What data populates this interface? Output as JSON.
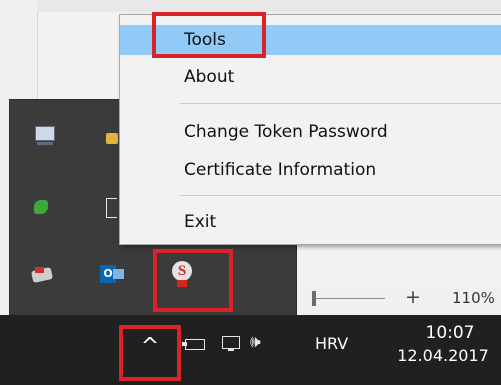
{
  "background": {
    "zoom": {
      "label": "110%",
      "plus_symbol": "+"
    }
  },
  "tray_overflow": {
    "icons": [
      "monitor-icon",
      "lock-icon",
      "green-app-icon",
      "usb-drive-icon",
      "printer-icon",
      "outlook-icon",
      "certificate-token-icon"
    ],
    "outlook_letter": "O",
    "cert_letter": "S"
  },
  "context_menu": {
    "items": [
      {
        "label": "Tools",
        "highlighted": true
      },
      {
        "label": "About"
      },
      {
        "label": "Change Token Password"
      },
      {
        "label": "Certificate Information"
      },
      {
        "label": "Exit"
      }
    ]
  },
  "taskbar": {
    "chevron": "^",
    "language": "HRV",
    "time": "10:07",
    "date": "12.04.2017",
    "volume_glyph": "🕪"
  },
  "colors": {
    "highlight": "#91c9f7",
    "annotation_red": "#d8232a",
    "taskbar": "#202020",
    "tray_panel": "#3b3b3b"
  }
}
